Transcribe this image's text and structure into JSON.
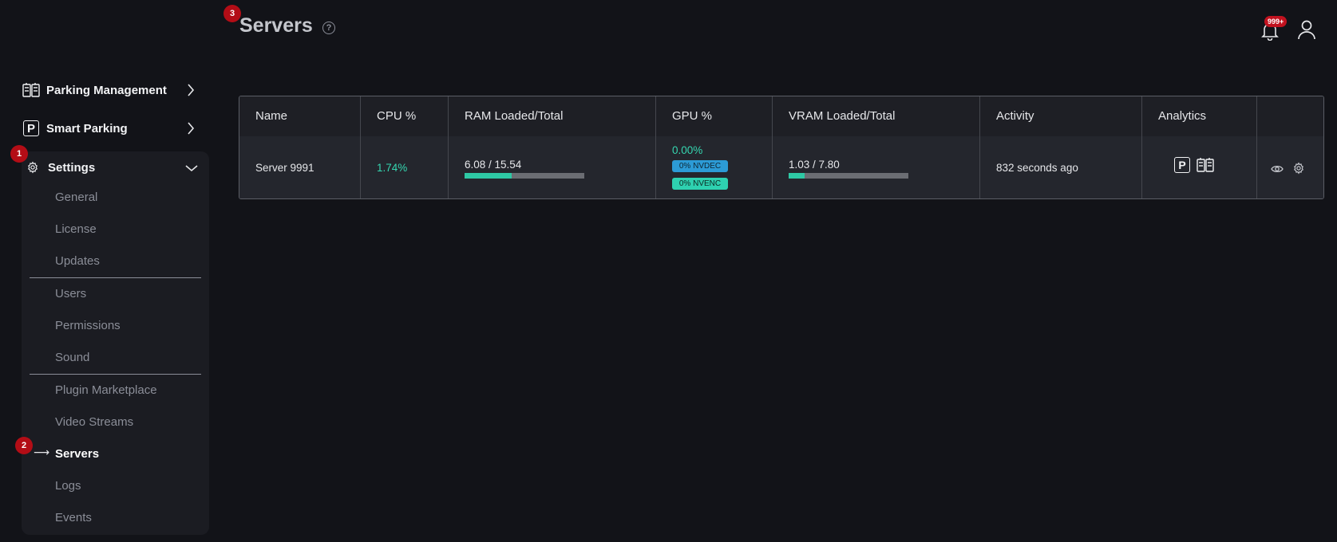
{
  "sidebar": {
    "parking_management": "Parking Management",
    "smart_parking": "Smart Parking",
    "smart_parking_icon_letter": "P",
    "settings": "Settings",
    "sub_items": {
      "general": "General",
      "license": "License",
      "updates": "Updates",
      "users": "Users",
      "permissions": "Permissions",
      "sound": "Sound",
      "plugin_marketplace": "Plugin Marketplace",
      "video_streams": "Video Streams",
      "servers": "Servers",
      "logs": "Logs",
      "events": "Events"
    },
    "active_arrow": "⟶"
  },
  "markers": {
    "m1": "1",
    "m2": "2",
    "m3": "3"
  },
  "header": {
    "title": "Servers",
    "help_glyph": "?",
    "notification_count": "999+"
  },
  "table": {
    "headers": {
      "name": "Name",
      "cpu": "CPU %",
      "ram": "RAM Loaded/Total",
      "gpu": "GPU %",
      "vram": "VRAM Loaded/Total",
      "activity": "Activity",
      "analytics": "Analytics"
    },
    "row": {
      "name": "Server 9991",
      "cpu": "1.74%",
      "ram_text": "6.08 / 15.54",
      "ram_fraction": 0.391,
      "gpu": "0.00%",
      "nvdec": "0% NVDEC",
      "nvenc": "0% NVENC",
      "vram_text": "1.03 / 7.80",
      "vram_fraction": 0.132,
      "activity": "832 seconds ago",
      "analytics_p": "P"
    }
  },
  "colors": {
    "background": "#121318",
    "accent_teal": "#35d6b0",
    "marker_red": "#b30d16",
    "nvdec_blue": "#2c9bd6"
  },
  "icons": [
    "parking-management-icon",
    "smart-parking-icon",
    "chevron-right-icon",
    "chevron-down-icon",
    "gear-icon",
    "help-icon",
    "bell-icon",
    "user-icon",
    "eye-icon",
    "settings-gear-icon"
  ]
}
